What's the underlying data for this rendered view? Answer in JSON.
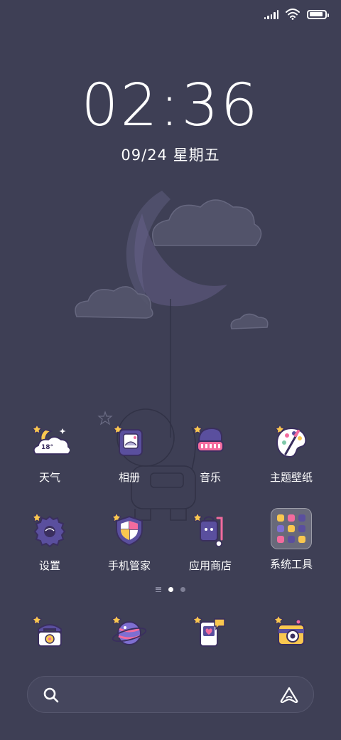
{
  "status_bar": {
    "signal_bars": 5,
    "battery_level": 0.9
  },
  "lockclock": {
    "time": "02:36",
    "date": "09/24 星期五"
  },
  "apps_row1": [
    {
      "label": "天气",
      "icon": "weather-icon",
      "badge": "18°"
    },
    {
      "label": "相册",
      "icon": "gallery-icon"
    },
    {
      "label": "音乐",
      "icon": "music-icon"
    },
    {
      "label": "主题壁纸",
      "icon": "themes-icon"
    }
  ],
  "apps_row2": [
    {
      "label": "设置",
      "icon": "settings-icon"
    },
    {
      "label": "手机管家",
      "icon": "security-icon"
    },
    {
      "label": "应用商店",
      "icon": "app-store-icon"
    },
    {
      "label": "系统工具",
      "icon": "folder-icon"
    }
  ],
  "dock": [
    {
      "icon": "phone-icon"
    },
    {
      "icon": "browser-icon"
    },
    {
      "icon": "messages-icon"
    },
    {
      "icon": "camera-icon"
    }
  ],
  "page_indicator": {
    "pages": 2,
    "active": 1
  },
  "colors": {
    "background": "#3e3f55",
    "accent_purple": "#5a4f9e",
    "accent_pink": "#f36b9e",
    "accent_yellow": "#f9c74f"
  }
}
